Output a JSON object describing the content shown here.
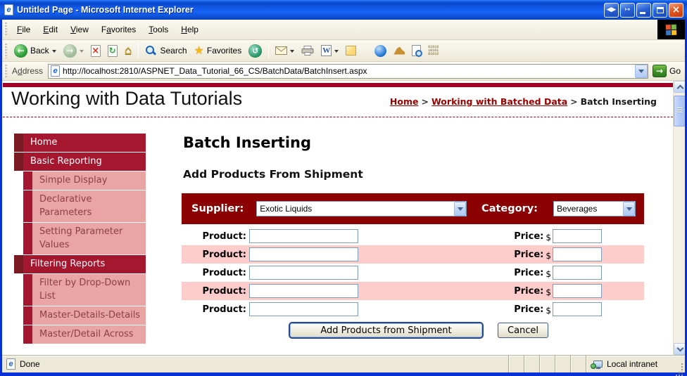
{
  "window": {
    "title": "Untitled Page - Microsoft Internet Explorer"
  },
  "menu": {
    "items": [
      {
        "pre": "",
        "key": "F",
        "post": "ile"
      },
      {
        "pre": "",
        "key": "E",
        "post": "dit"
      },
      {
        "pre": "",
        "key": "V",
        "post": "iew"
      },
      {
        "pre": "F",
        "key": "a",
        "post": "vorites"
      },
      {
        "pre": "",
        "key": "T",
        "post": "ools"
      },
      {
        "pre": "",
        "key": "H",
        "post": "elp"
      }
    ]
  },
  "toolbar": {
    "back": "Back",
    "search": "Search",
    "favorites": "Favorites"
  },
  "address": {
    "label_pre": "A",
    "label_key": "d",
    "label_post": "dress",
    "url": "http://localhost:2810/ASPNET_Data_Tutorial_66_CS/BatchData/BatchInsert.aspx",
    "go": "Go"
  },
  "page": {
    "site_title": "Working with Data Tutorials",
    "breadcrumb": {
      "home": "Home",
      "sep": ">",
      "section": "Working with Batched Data",
      "current": "Batch Inserting"
    },
    "sidebar": {
      "items": [
        "Home",
        "Basic Reporting",
        "Simple Display",
        "Declarative Parameters",
        "Setting Parameter Values",
        "Filtering Reports",
        "Filter by Drop-Down List",
        "Master-Details-Details",
        "Master/Detail Across"
      ]
    },
    "main": {
      "heading": "Batch Inserting",
      "subheading": "Add Products From Shipment",
      "supplier_label": "Supplier:",
      "supplier_value": "Exotic Liquids",
      "category_label": "Category:",
      "category_value": "Beverages",
      "rows": [
        {
          "product_label": "Product:",
          "product_value": "",
          "price_label": "Price:",
          "currency": "$",
          "price_value": ""
        },
        {
          "product_label": "Product:",
          "product_value": "",
          "price_label": "Price:",
          "currency": "$",
          "price_value": ""
        },
        {
          "product_label": "Product:",
          "product_value": "",
          "price_label": "Price:",
          "currency": "$",
          "price_value": ""
        },
        {
          "product_label": "Product:",
          "product_value": "",
          "price_label": "Price:",
          "currency": "$",
          "price_value": ""
        },
        {
          "product_label": "Product:",
          "product_value": "",
          "price_label": "Price:",
          "currency": "$",
          "price_value": ""
        }
      ],
      "submit": "Add Products from Shipment",
      "cancel": "Cancel"
    }
  },
  "status": {
    "left": "Done",
    "zone": "Local intranet"
  },
  "colors": {
    "title_blue": "#0F57E0",
    "chrome_beige": "#ECE9D8",
    "supplier_bar_red": "#8B0000",
    "top_bar_red": "#A00023",
    "nav_red": "#A5162F",
    "nav_dark_red": "#7A1A22",
    "nav_pink": "#E9A4A4",
    "row_pink": "#FFCCCC",
    "link_red": "#990000"
  }
}
